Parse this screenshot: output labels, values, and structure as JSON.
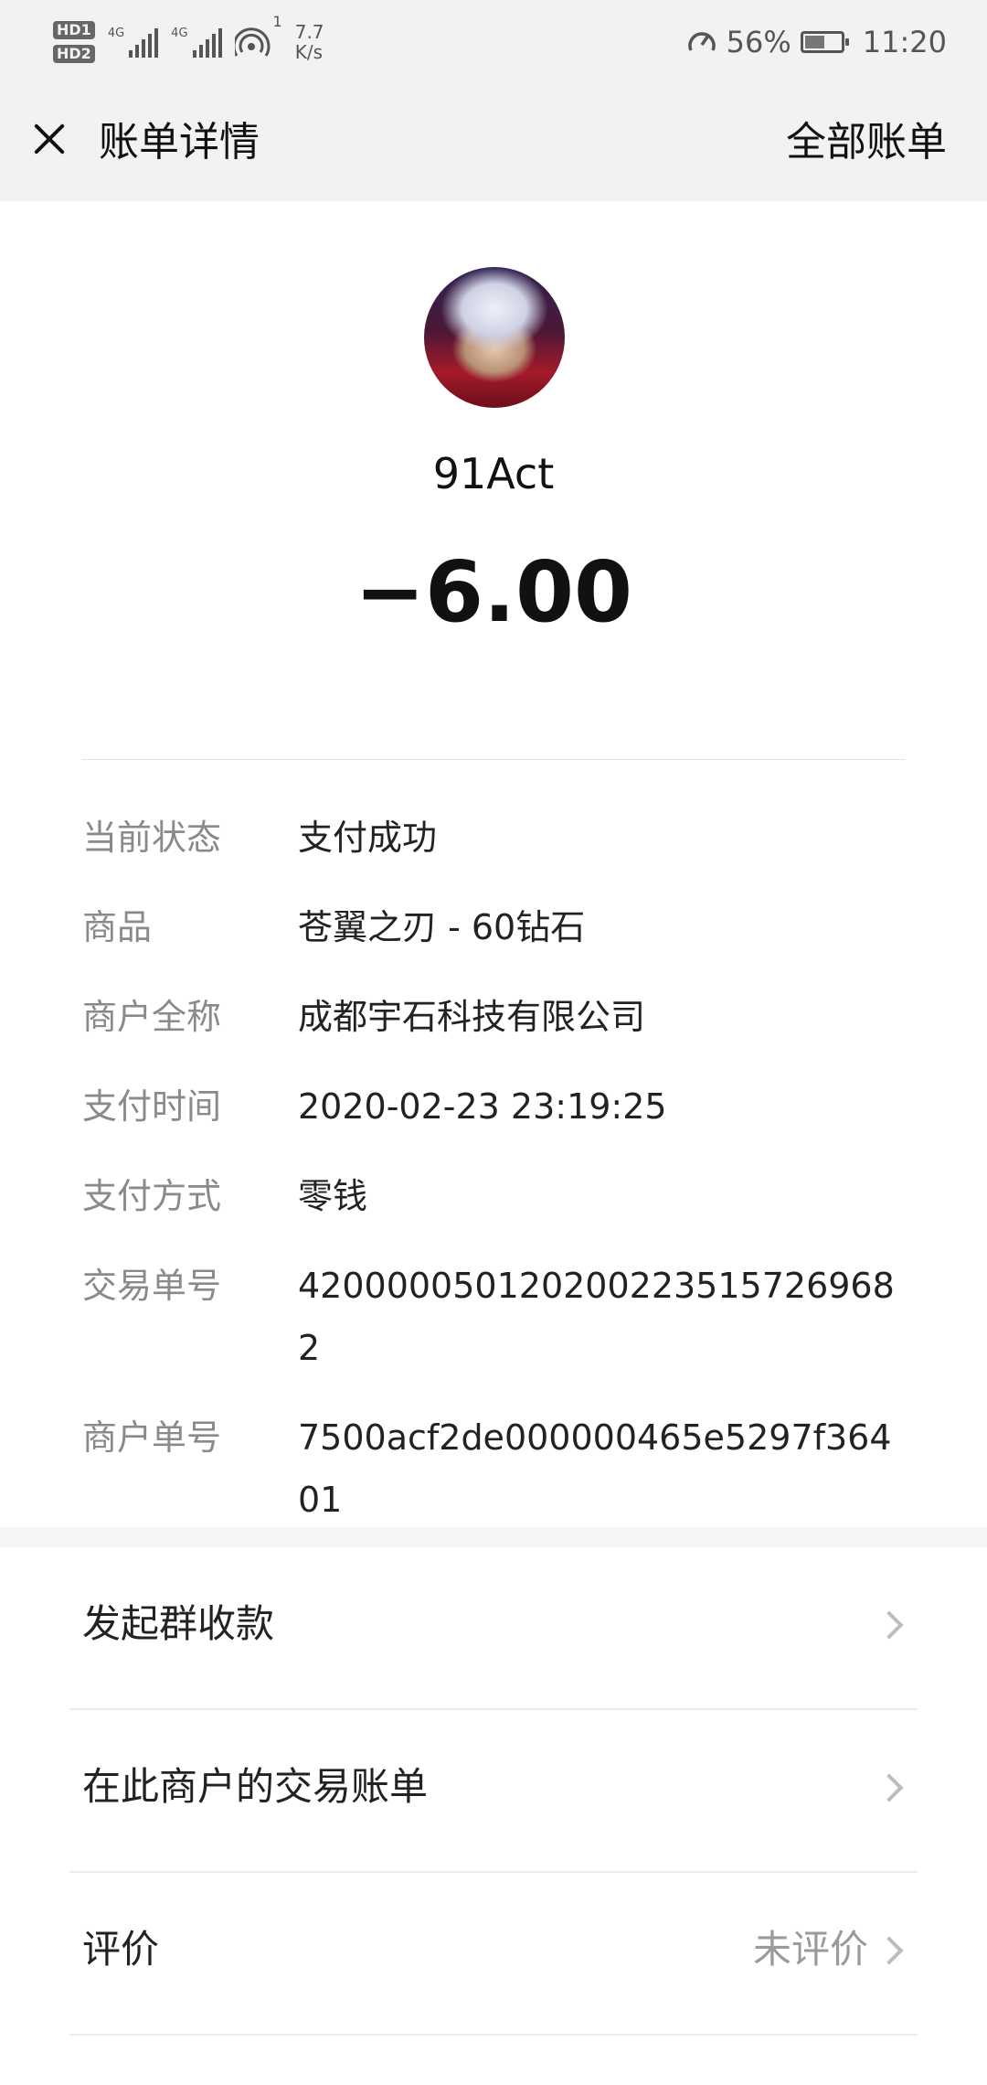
{
  "status_bar": {
    "hd1": "HD1",
    "hd2": "HD2",
    "net1": "4G",
    "net2": "4G",
    "wifi_badge": "1",
    "net_speed_value": "7.7",
    "net_speed_unit": "K/s",
    "battery_percent": "56%",
    "battery_level": 0.56,
    "time": "11:20"
  },
  "nav": {
    "title": "账单详情",
    "action": "全部账单",
    "close_icon": "close-icon"
  },
  "header": {
    "merchant": "91Act",
    "amount": "−6.00"
  },
  "details": [
    {
      "label": "当前状态",
      "value": "支付成功"
    },
    {
      "label": "商品",
      "value": "苍翼之刃 - 60钻石"
    },
    {
      "label": "商户全称",
      "value": "成都宇石科技有限公司"
    },
    {
      "label": "支付时间",
      "value": "2020-02-23 23:19:25"
    },
    {
      "label": "支付方式",
      "value": "零钱"
    },
    {
      "label": "交易单号",
      "value": "4200000501202002235157269682"
    },
    {
      "label": "商户单号",
      "value": "7500acf2de000000465e5297f36401"
    }
  ],
  "actions": [
    {
      "label": "发起群收款",
      "value": ""
    },
    {
      "label": "在此商户的交易账单",
      "value": ""
    },
    {
      "label": "评价",
      "value": "未评价"
    }
  ]
}
